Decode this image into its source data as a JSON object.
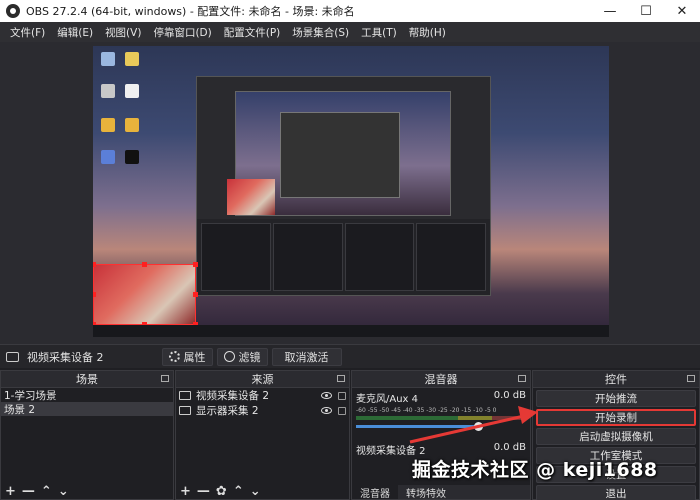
{
  "window": {
    "title": "OBS 27.2.4 (64-bit, windows) - 配置文件: 未命名 - 场景: 未命名",
    "minimize": "—",
    "maximize": "☐",
    "close": "✕"
  },
  "menu": [
    "文件(F)",
    "编辑(E)",
    "视图(V)",
    "停靠窗口(D)",
    "配置文件(P)",
    "场景集合(S)",
    "工具(T)",
    "帮助(H)"
  ],
  "source_toolbar": {
    "source_name": "视频采集设备 2",
    "properties": "属性",
    "filters": "滤镜",
    "deactivate": "取消激活"
  },
  "scenes": {
    "header": "场景",
    "items": [
      "1-学习场景",
      "场景 2"
    ],
    "selected_index": 1
  },
  "sources": {
    "header": "来源",
    "items": [
      "视频采集设备 2",
      "显示器采集 2"
    ]
  },
  "mixer": {
    "header": "混音器",
    "channels": [
      {
        "name": "麦克风/Aux 4",
        "db": "0.0 dB"
      },
      {
        "name": "视频采集设备 2",
        "db": "0.0 dB"
      }
    ],
    "scale": "-60 -55 -50 -45 -40 -35 -30 -25 -20 -15 -10 -5 0",
    "tabs": [
      "混音器",
      "转场特效"
    ]
  },
  "controls": {
    "header": "控件",
    "buttons": [
      "开始推流",
      "开始录制",
      "启动虚拟摄像机",
      "工作室模式",
      "设置",
      "退出"
    ],
    "highlighted_index": 1
  },
  "watermark": "掘金技术社区 @ keji1688",
  "colors": {
    "accent_red": "#e53935",
    "slider_blue": "#4a8ed8",
    "panel_bg": "#1f1f23"
  }
}
